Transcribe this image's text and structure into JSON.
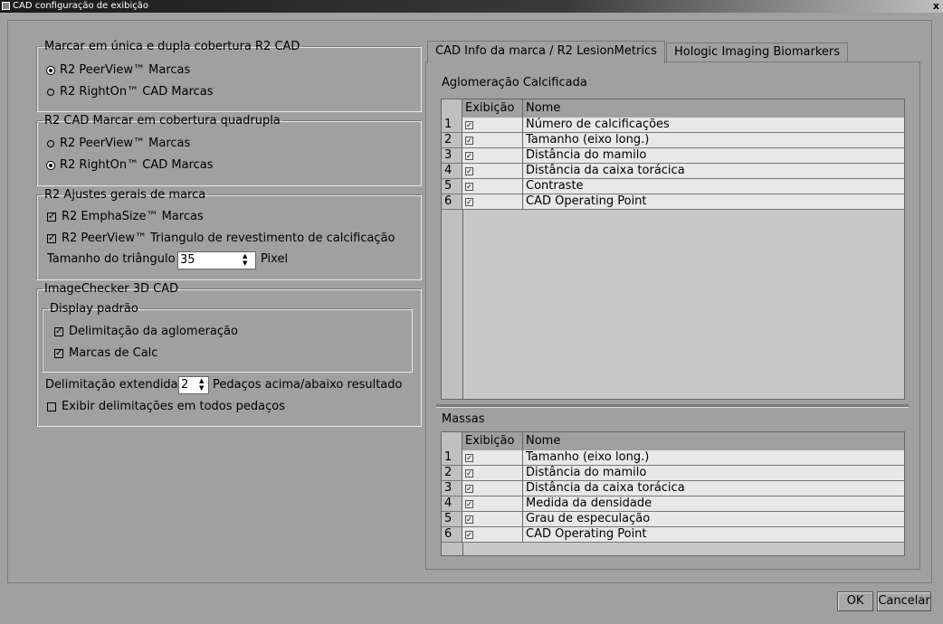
{
  "window": {
    "title": "CAD configuração de exibição",
    "close_glyph": "x"
  },
  "left": {
    "group1": {
      "legend": "Marcar em única e dupla cobertura R2 CAD",
      "options": [
        {
          "label": "R2 PeerView™  Marcas",
          "selected": true
        },
        {
          "label": "R2 RightOn™ CAD Marcas",
          "selected": false
        }
      ]
    },
    "group2": {
      "legend": "R2 CAD Marcar em cobertura quadrupla",
      "options": [
        {
          "label": "R2 PeerView™  Marcas",
          "selected": false
        },
        {
          "label": "R2 RightOn™ CAD Marcas",
          "selected": true
        }
      ]
    },
    "group3": {
      "legend": "R2 Ajustes gerais de marca",
      "checks": [
        {
          "label": "R2 EmphaSize™ Marcas",
          "checked": true
        },
        {
          "label": "R2 PeerView™ Triangulo  de revestimento de calcificação",
          "checked": true
        }
      ],
      "triangle_label": "Tamanho do triângulo",
      "triangle_value": "35",
      "triangle_unit": "Pixel"
    },
    "group4": {
      "legend": "ImageChecker 3D CAD",
      "sub_legend": "Display padrão",
      "sub_checks": [
        {
          "label": "Delimitação da aglomeração",
          "checked": true
        },
        {
          "label": "Marcas de Calc",
          "checked": true
        }
      ],
      "extended_label": "Delimitação extendida",
      "extended_value": "2",
      "extended_suffix": "Pedaços acima/abaixo resultado",
      "all_slices": {
        "label": "Exibir delimitações em todos pedaços",
        "checked": false
      }
    }
  },
  "tabs": [
    {
      "label": "CAD Info da marca / R2 LesionMetrics",
      "active": true
    },
    {
      "label": "Hologic Imaging Biomarkers",
      "active": false
    }
  ],
  "calc": {
    "title": "Aglomeração Calcificada",
    "headers": [
      "",
      "Exibição",
      "Nome"
    ],
    "rows": [
      {
        "num": "1",
        "checked": true,
        "name": "Número de calcificações"
      },
      {
        "num": "2",
        "checked": true,
        "name": "Tamanho (eixo long.)"
      },
      {
        "num": "3",
        "checked": true,
        "name": "Distância do mamilo"
      },
      {
        "num": "4",
        "checked": true,
        "name": "Distância da caixa torácica"
      },
      {
        "num": "5",
        "checked": true,
        "name": "Contraste"
      },
      {
        "num": "6",
        "checked": true,
        "name": "CAD Operating Point"
      }
    ]
  },
  "mass": {
    "title": "Massas",
    "headers": [
      "",
      "Exibição",
      "Nome"
    ],
    "rows": [
      {
        "num": "1",
        "checked": true,
        "name": "Tamanho (eixo long.)"
      },
      {
        "num": "2",
        "checked": true,
        "name": "Distância do mamilo"
      },
      {
        "num": "3",
        "checked": true,
        "name": "Distância da caixa torácica"
      },
      {
        "num": "4",
        "checked": true,
        "name": "Medida da densidade"
      },
      {
        "num": "5",
        "checked": true,
        "name": "Grau de especulação"
      },
      {
        "num": "6",
        "checked": true,
        "name": "CAD Operating Point"
      }
    ]
  },
  "buttons": {
    "ok": "OK",
    "cancel": "Cancelar"
  },
  "icons": {
    "checkmark": "✓",
    "spinner_up": "▲",
    "spinner_down": "▼"
  }
}
